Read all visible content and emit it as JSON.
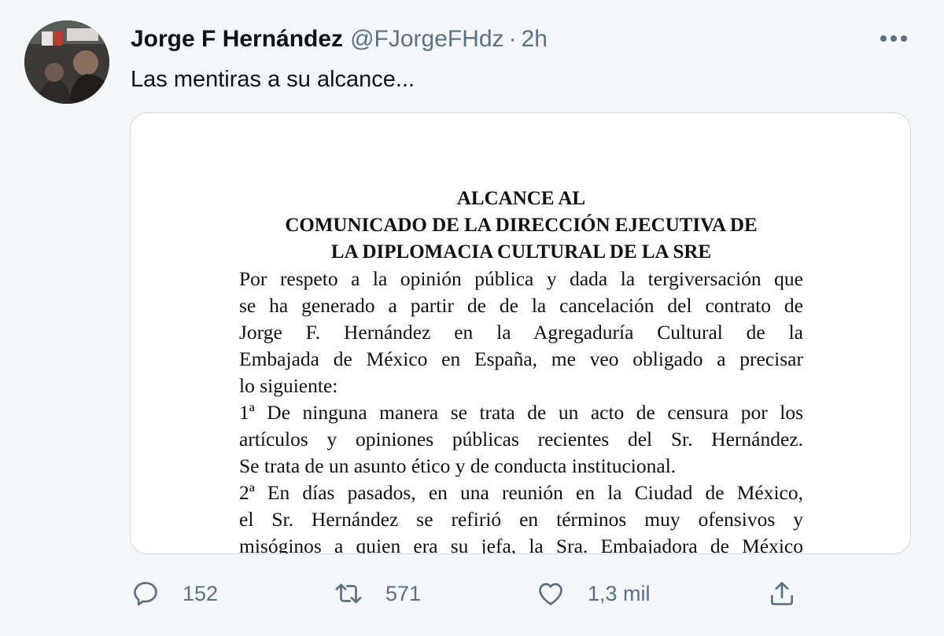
{
  "tweet": {
    "author_name": "Jorge F Hernández",
    "handle": "@FJorgeFHdz",
    "separator": "·",
    "time": "2h",
    "text": "Las mentiras a su alcance...",
    "more_icon": "more-horizontal-icon"
  },
  "document": {
    "title_lines": [
      "ALCANCE AL",
      "COMUNICADO DE LA DIRECCIÓN EJECUTIVA DE",
      "LA DIPLOMACIA CULTURAL DE LA SRE"
    ],
    "lines": [
      "Por respeto a la opinión pública y dada la tergiversación que",
      "se ha generado a partir de de la cancelación del contrato de",
      "Jorge F. Hernández en la Agregaduría Cultural de la",
      "Embajada de México en España, me veo obligado a precisar",
      "lo siguiente:",
      "1ª De ninguna manera se trata de un acto de censura por los",
      "artículos y opiniones públicas recientes del Sr. Hernández.",
      "Se trata de un asunto ético y de conducta institucional.",
      "2ª En días pasados, en una reunión en la Ciudad de México,",
      "el Sr. Hernández se refirió en términos muy ofensivos y",
      "misóginos a quien era su jefa, la Sra. Embajadora de México"
    ]
  },
  "actions": {
    "reply_count": "152",
    "retweet_count": "571",
    "like_count": "1,3 mil",
    "icons": [
      "reply-icon",
      "retweet-icon",
      "like-icon",
      "share-icon"
    ]
  },
  "colors": {
    "background": "#f5f8fa",
    "text": "#0f1419",
    "secondary": "#5b7083",
    "border": "#cfd9de"
  }
}
